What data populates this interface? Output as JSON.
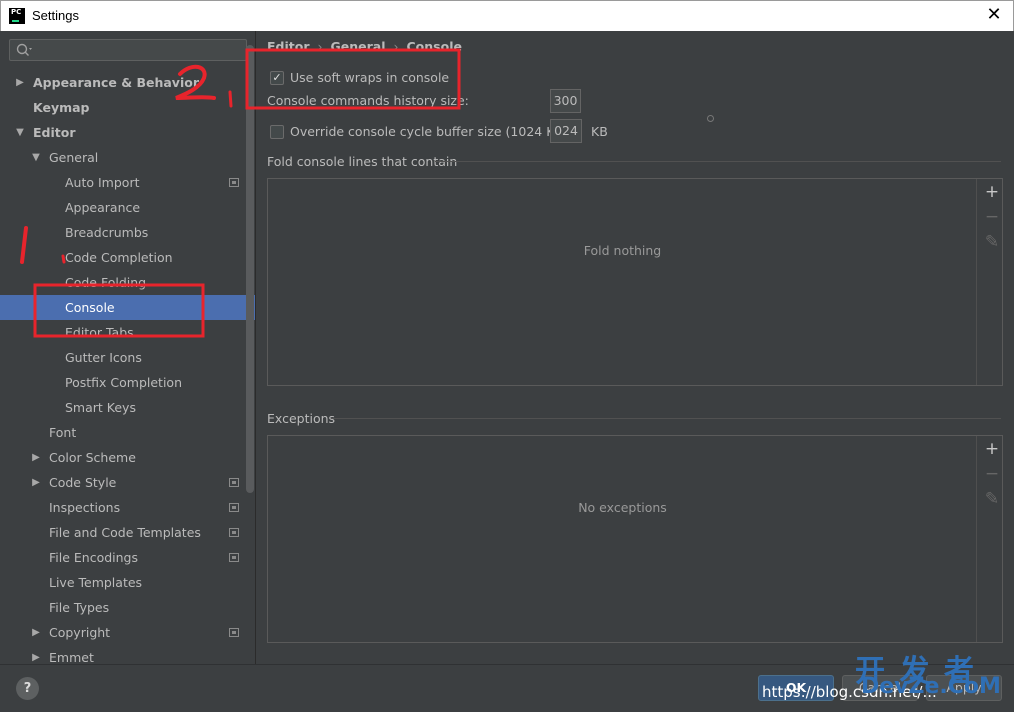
{
  "window": {
    "title": "Settings",
    "close_glyph": "✕",
    "app_icon_text": "PC"
  },
  "search": {
    "value": "",
    "placeholder": "",
    "icon": "search-icon"
  },
  "tree": [
    {
      "label": "Appearance & Behavior",
      "level": 0,
      "arrow": "▶",
      "bold": true
    },
    {
      "label": "Keymap",
      "level": 0,
      "arrow": "",
      "bold": true
    },
    {
      "label": "Editor",
      "level": 0,
      "arrow": "▼",
      "bold": true
    },
    {
      "label": "General",
      "level": 1,
      "arrow": "▼"
    },
    {
      "label": "Auto Import",
      "level": 2,
      "arrow": "",
      "project": true
    },
    {
      "label": "Appearance",
      "level": 2,
      "arrow": ""
    },
    {
      "label": "Breadcrumbs",
      "level": 2,
      "arrow": ""
    },
    {
      "label": "Code Completion",
      "level": 2,
      "arrow": ""
    },
    {
      "label": "Code Folding",
      "level": 2,
      "arrow": ""
    },
    {
      "label": "Console",
      "level": 2,
      "arrow": "",
      "selected": true
    },
    {
      "label": "Editor Tabs",
      "level": 2,
      "arrow": ""
    },
    {
      "label": "Gutter Icons",
      "level": 2,
      "arrow": ""
    },
    {
      "label": "Postfix Completion",
      "level": 2,
      "arrow": ""
    },
    {
      "label": "Smart Keys",
      "level": 2,
      "arrow": ""
    },
    {
      "label": "Font",
      "level": 1,
      "arrow": ""
    },
    {
      "label": "Color Scheme",
      "level": 1,
      "arrow": "▶"
    },
    {
      "label": "Code Style",
      "level": 1,
      "arrow": "▶",
      "project": true
    },
    {
      "label": "Inspections",
      "level": 1,
      "arrow": "",
      "project": true
    },
    {
      "label": "File and Code Templates",
      "level": 1,
      "arrow": "",
      "project": true
    },
    {
      "label": "File Encodings",
      "level": 1,
      "arrow": "",
      "project": true
    },
    {
      "label": "Live Templates",
      "level": 1,
      "arrow": ""
    },
    {
      "label": "File Types",
      "level": 1,
      "arrow": ""
    },
    {
      "label": "Copyright",
      "level": 1,
      "arrow": "▶",
      "project": true
    },
    {
      "label": "Emmet",
      "level": 1,
      "arrow": "▶"
    }
  ],
  "breadcrumbs": {
    "editor": "Editor",
    "general": "General",
    "console": "Console",
    "separator": "›"
  },
  "console": {
    "soft_wraps_label": "Use soft wraps in console",
    "soft_wraps_checked": "✓",
    "history_label": "Console commands history size:",
    "history_value": "300",
    "override_label": "Override console cycle buffer size (1024 KB)",
    "override_value": "024",
    "override_unit": "KB"
  },
  "fold": {
    "title": "Fold console lines that contain",
    "empty_text": "Fold nothing"
  },
  "exceptions": {
    "title": "Exceptions",
    "empty_text": "No exceptions"
  },
  "tools": {
    "add": "+",
    "remove": "−",
    "edit": "✎"
  },
  "bottom": {
    "help": "?",
    "ok": "OK",
    "cancel": "Cancel",
    "apply": "Apply"
  },
  "watermarks": {
    "url": "https://blog.csdn.net/...",
    "site_cn": "开 发 者",
    "site_en": "DevZe.CoM"
  },
  "annotations": {
    "label_one": "1",
    "label_two": "2",
    "color": "#e8242c"
  }
}
